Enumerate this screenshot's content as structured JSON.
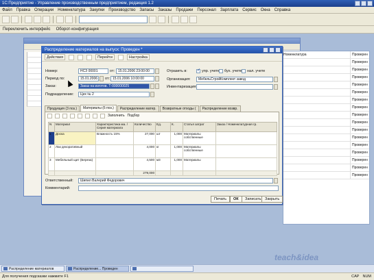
{
  "app": {
    "title": "1С:Предприятие - Управление производственным предприятием, редакция 1.2",
    "menu": [
      "Файл",
      "Правка",
      "Операции",
      "Номенклатура",
      "Закупки",
      "Производство",
      "Запасы",
      "Заказы",
      "Продажи",
      "Персонал",
      "Зарплата",
      "Сервис",
      "Окна",
      "Справка"
    ],
    "toolbar2": [
      "Переключить интерфейс",
      "Оборот-конфигурация"
    ]
  },
  "dialog": {
    "title": "Распределение материалов на выпуск: Проведен *",
    "toolbar": {
      "actions": "Действия",
      "goto": "Перейти",
      "settings": "Настройка"
    },
    "fields": {
      "number_label": "Номер:",
      "number_value": "НСЗ 00001",
      "from_label": "от:",
      "date_value": "15.01.2006 23:00:00",
      "period_label": "Период по:",
      "period_from": "15.01.2006",
      "period_to": "15.01.2006 10:00:00",
      "order_label": "Заказ:",
      "order_value": "Заказ на изготов. Т-000000025",
      "division_label": "Подразделение:",
      "division_value": "Цех № 2",
      "reflect_label": "Отразить в:",
      "mgmt_label": "упр. учете",
      "acc_label": "бух. учете",
      "tax_label": "нал. учете",
      "org_label": "Организация:",
      "org_value": "МебельСтройКомплект завод",
      "inv_label": "Инвентаризация:",
      "inv_value": ""
    },
    "tabs": [
      "Продукция (3 поз.)",
      "Материалы (6 поз.)",
      "Распределение матер.",
      "Возвратные отходы (",
      "Распределение возвр."
    ],
    "grid_toolbar": {
      "fill": "Заполнить",
      "select": "Подбор"
    },
    "grid": {
      "headers": [
        "N",
        "Материал",
        "Характеристика ма. / Серия материала",
        "Количество",
        "Ед.",
        "К.",
        "Статья затрат",
        "Заказ / Номенклатурная гр."
      ],
      "rows": [
        {
          "n": "1",
          "material": "Доска",
          "char": "Влажность 15%",
          "qty": "27,000",
          "unit": "шт",
          "k": "1,000",
          "cost": "Материалы собственные",
          "order": ""
        },
        {
          "n": "2",
          "material": "Лак декоративный",
          "char": "",
          "qty": "4,000",
          "unit": "кг",
          "k": "1,000",
          "cost": "Материалы собственные",
          "order": ""
        },
        {
          "n": "3",
          "material": "Мебельный щит (Береза)",
          "char": "",
          "qty": "4,500",
          "unit": "м3",
          "k": "1,000",
          "cost": "Материалы",
          "order": ""
        }
      ],
      "total": "279,000"
    },
    "responsible_label": "Ответственный:",
    "responsible_value": "Шипил Валерий Федорович",
    "comment_label": "Комментарий:",
    "comment_value": "",
    "buttons": {
      "print": "Печать",
      "ok": "ОК",
      "save": "Записать",
      "close": "Закрыть"
    }
  },
  "right_list": {
    "rows": [
      [
        "Номенклатура",
        "Проверен"
      ],
      [
        "",
        "Проверен"
      ],
      [
        "",
        "Проверен"
      ],
      [
        "",
        "Проверен"
      ],
      [
        "",
        "Проверен"
      ],
      [
        "",
        "Проверен"
      ],
      [
        "",
        "Проверен"
      ],
      [
        "",
        "Проверен"
      ],
      [
        "",
        "Проверен"
      ],
      [
        "",
        "Проверен"
      ],
      [
        "",
        "Проверен"
      ],
      [
        "",
        "Проверен"
      ],
      [
        "",
        "Проверен"
      ],
      [
        "",
        "Проверен"
      ],
      [
        "",
        "Проверен"
      ],
      [
        "",
        "Проверен"
      ],
      [
        "",
        "Проверен"
      ]
    ]
  },
  "taskbar": [
    "Распределение материалов",
    "Распределение... Проведен",
    ""
  ],
  "status": {
    "text": "Для получения подсказки нажмите F1",
    "caps": "CAP",
    "num": "NUM"
  },
  "watermark": "teach&idea"
}
